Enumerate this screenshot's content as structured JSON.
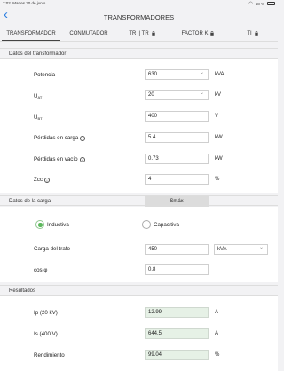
{
  "status": {
    "time": "7:02",
    "date": "Martes 30 de junio",
    "battery": "68 %"
  },
  "nav": {
    "title": "TRANSFORMADORES"
  },
  "tabs": [
    {
      "label": "TRANSFORMADOR",
      "locked": false
    },
    {
      "label": "CONMUTADOR",
      "locked": false
    },
    {
      "label": "TR || TR",
      "locked": true
    },
    {
      "label": "FACTOR K",
      "locked": true
    },
    {
      "label": "TI",
      "locked": true
    }
  ],
  "sections": {
    "datos": "Datos del transformador",
    "carga": "Datos de la carga",
    "resultados": "Resultados"
  },
  "transformer": {
    "potencia": {
      "label": "Potencia",
      "value": "630",
      "unit": "kVA"
    },
    "uat": {
      "label": "U",
      "sub": "AT",
      "value": "20",
      "unit": "kV"
    },
    "ubt": {
      "label": "U",
      "sub": "BT",
      "value": "400",
      "unit": "V"
    },
    "perdidas_carga": {
      "label": "Pérdidas en carga",
      "value": "5.4",
      "unit": "kW"
    },
    "perdidas_vacio": {
      "label": "Pérdidas en vacío",
      "value": "0.73",
      "unit": "kW"
    },
    "zcc": {
      "label": "Zcc",
      "value": "4",
      "unit": "%"
    }
  },
  "carga": {
    "smax": "Smáx",
    "inductiva": "Inductiva",
    "capacitiva": "Capacitiva",
    "carga_trafo": {
      "label": "Carga del trafo",
      "value": "450",
      "unit": "kVA"
    },
    "cosphi": {
      "label": "cos φ",
      "value": "0.8"
    }
  },
  "resultados": {
    "ip": {
      "label": "Ip (20 kV)",
      "value": "12.99",
      "unit": "A"
    },
    "is": {
      "label": "Is (400 V)",
      "value": "644.5",
      "unit": "A"
    },
    "rendimiento": {
      "label": "Rendimiento",
      "value": "99.04",
      "unit": "%"
    }
  },
  "colors": {
    "accent": "#2a7de1",
    "radio": "#5cb85c",
    "result_bg": "#e6f1e6"
  }
}
